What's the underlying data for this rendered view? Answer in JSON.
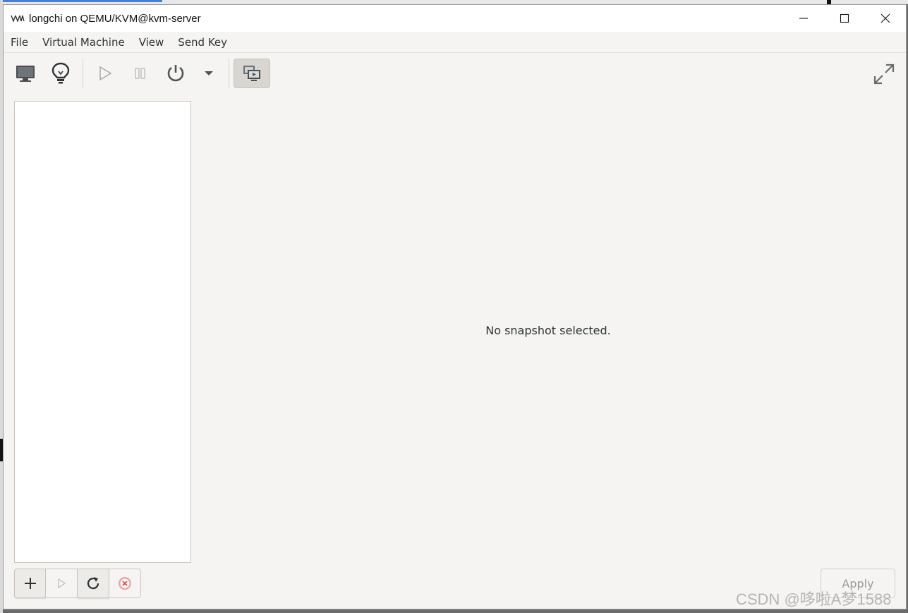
{
  "window": {
    "title": "longchi on QEMU/KVM@kvm-server",
    "controls": [
      "minimize",
      "maximize",
      "close"
    ]
  },
  "menubar": {
    "items": [
      "File",
      "Virtual Machine",
      "View",
      "Send Key"
    ]
  },
  "toolbar": {
    "buttons": [
      {
        "icon": "monitor-icon",
        "label": "Show the graphical console"
      },
      {
        "icon": "lightbulb-icon",
        "label": "Show virtual hardware details"
      },
      {
        "icon": "play-icon",
        "label": "Run"
      },
      {
        "icon": "pause-icon",
        "label": "Pause"
      },
      {
        "icon": "power-icon",
        "label": "Shut down"
      },
      {
        "icon": "chevron-down-icon",
        "label": "Shutdown menu"
      },
      {
        "icon": "snapshots-icon",
        "label": "Manage VM snapshots",
        "active": true
      }
    ],
    "fullscreen_icon": "fullscreen-icon"
  },
  "snapshots": {
    "items": [],
    "empty_message": "No snapshot selected."
  },
  "bottom_bar": {
    "buttons": [
      {
        "icon": "plus-icon"
      },
      {
        "icon": "play-icon"
      },
      {
        "icon": "refresh-icon"
      },
      {
        "icon": "delete-icon"
      }
    ],
    "apply_label": "Apply"
  },
  "watermark": "CSDN @哆啦A梦1588",
  "colors": {
    "window_bg": "#f5f4f2",
    "titlebar_bg": "#ffffff",
    "delete_red": "#e05a5a",
    "disabled_text": "#9a9a98"
  }
}
